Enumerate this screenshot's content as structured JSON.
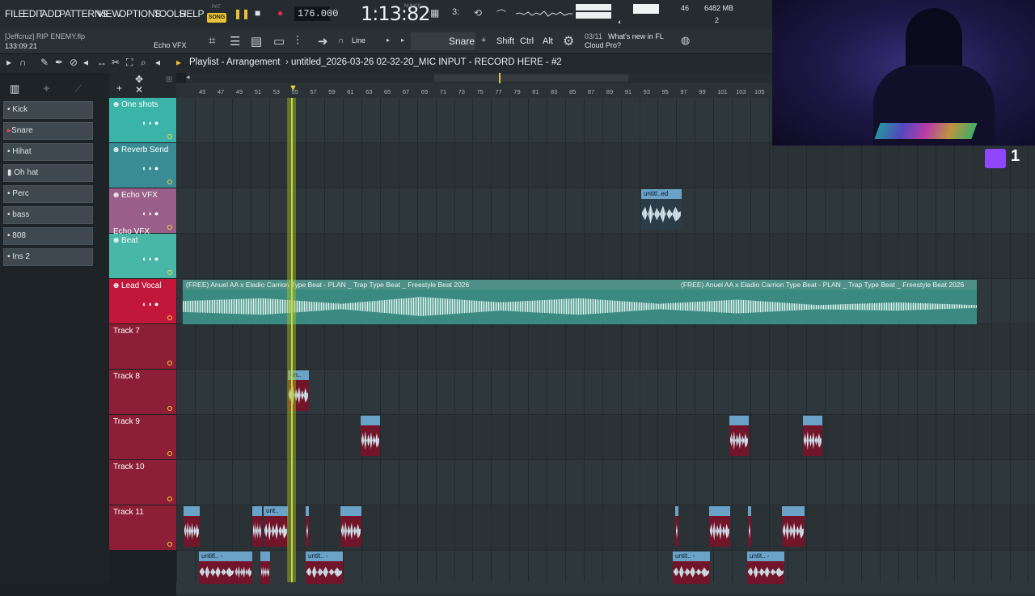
{
  "menu": [
    "FILE",
    "EDIT",
    "ADD",
    "PATTERNS",
    "VIEW",
    "OPTIONS",
    "TOOLS",
    "HELP"
  ],
  "transport": {
    "pat_label": "PAT",
    "song_label": "SONG",
    "bpm": "176.000",
    "time": "1:13:82",
    "mcs": "M:S:CS"
  },
  "system": {
    "cpu": "46",
    "ram": "6482 MB",
    "poly": "2"
  },
  "project": {
    "user_file": "[Jeffcruz] RIP ENEMY.flp",
    "position": "133:09:21",
    "channel": "Echo VFX"
  },
  "tools": {
    "snap": "Line",
    "channel_sel": "Snare",
    "keys": [
      "Shift",
      "Ctrl",
      "Alt"
    ]
  },
  "news": {
    "date": "03/11",
    "line1": "What's new in FL",
    "line2": "Cloud Pro?"
  },
  "playlist": {
    "title": "Playlist - Arrangement",
    "pattern": "untitled_2026-03-26 02-32-20_MIC INPUT - RECORD HERE - #2"
  },
  "browser_items": [
    "Kick",
    "Snare",
    "Hihat",
    "Oh hat",
    "Perc",
    "bass",
    "808",
    "Ins 2"
  ],
  "ruler": [
    "45",
    "47",
    "49",
    "51",
    "53",
    "55",
    "57",
    "59",
    "61",
    "63",
    "65",
    "67",
    "69",
    "71",
    "73",
    "75",
    "77",
    "79",
    "81",
    "83",
    "85",
    "87",
    "89",
    "91",
    "93",
    "95",
    "97",
    "99",
    "101",
    "103",
    "105"
  ],
  "tracks": [
    {
      "name": "One shots",
      "color": "#3ab3a9"
    },
    {
      "name": "Reverb Send",
      "color": "#3a8c94"
    },
    {
      "name": "Echo VFX",
      "color": "#9a5e8a",
      "sub": "Echo VFX"
    },
    {
      "name": "Beat",
      "color": "#49b7a7"
    },
    {
      "name": "Lead Vocal",
      "color": "#c2163a"
    },
    {
      "name": "Track 7",
      "color": "#8c1f36"
    },
    {
      "name": "Track 8",
      "color": "#8c1f36"
    },
    {
      "name": "Track 9",
      "color": "#8c1f36"
    },
    {
      "name": "Track 10",
      "color": "#8c1f36"
    },
    {
      "name": "Track 11",
      "color": "#8c1f36"
    }
  ],
  "beat_clip": "(FREE) Anuel AA x Eladio Carrion Type Beat - PLAN _ Trap Type Beat _ Freestyle  Beat 2026",
  "clip_labels": {
    "echo": "untitl..ed",
    "t7": "un..",
    "t10b": "unt..",
    "t11a": "untitl.. -",
    "t11c": "untit.. -",
    "t11d": "untit.. -",
    "t11e": "untit.. -"
  },
  "twitch": {
    "count": "1"
  }
}
